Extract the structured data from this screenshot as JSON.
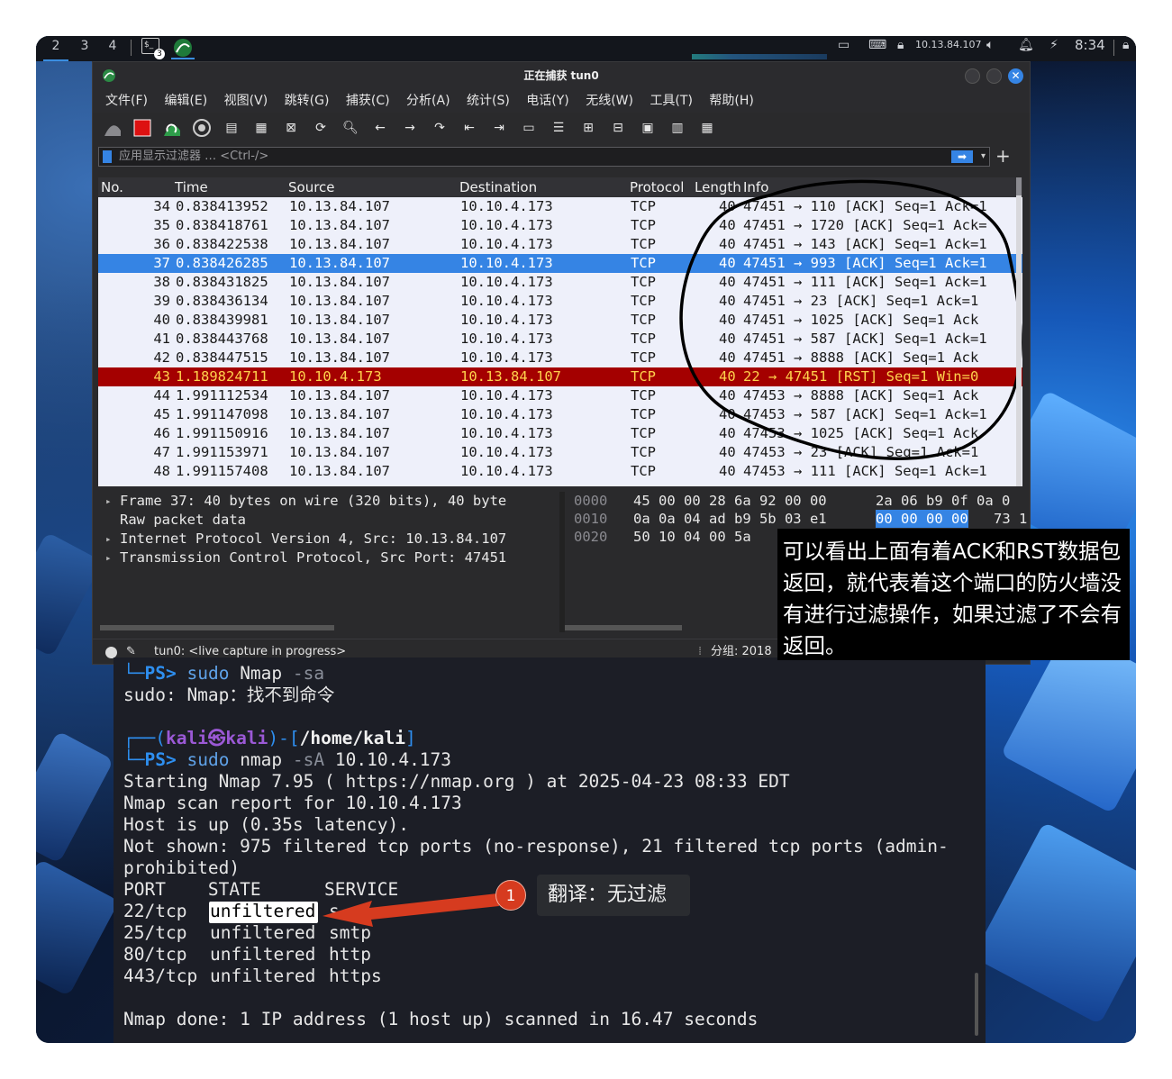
{
  "panel": {
    "workspaces": [
      "2",
      "3",
      "4"
    ],
    "terminal_count": "3",
    "ip": "10.13.84.107",
    "clock": "8:34"
  },
  "wireshark": {
    "title": "正在捕获 tun0",
    "menus": [
      "文件(F)",
      "编辑(E)",
      "视图(V)",
      "跳转(G)",
      "捕获(C)",
      "分析(A)",
      "统计(S)",
      "电话(Y)",
      "无线(W)",
      "工具(T)",
      "帮助(H)"
    ],
    "filter_placeholder": "应用显示过滤器 … <Ctrl-/>",
    "columns": [
      "No.",
      "Time",
      "Source",
      "Destination",
      "Protocol",
      "Length",
      "Info"
    ],
    "packets": [
      {
        "no": "34",
        "time": "0.838413952",
        "src": "10.13.84.107",
        "dst": "10.10.4.173",
        "proto": "TCP",
        "len": "40",
        "info": "47451 → 110 [ACK] Seq=1 Ack=1",
        "style": ""
      },
      {
        "no": "35",
        "time": "0.838418761",
        "src": "10.13.84.107",
        "dst": "10.10.4.173",
        "proto": "TCP",
        "len": "40",
        "info": "47451 → 1720 [ACK] Seq=1 Ack=",
        "style": ""
      },
      {
        "no": "36",
        "time": "0.838422538",
        "src": "10.13.84.107",
        "dst": "10.10.4.173",
        "proto": "TCP",
        "len": "40",
        "info": "47451 → 143 [ACK] Seq=1 Ack=1",
        "style": ""
      },
      {
        "no": "37",
        "time": "0.838426285",
        "src": "10.13.84.107",
        "dst": "10.10.4.173",
        "proto": "TCP",
        "len": "40",
        "info": "47451 → 993 [ACK] Seq=1 Ack=1",
        "style": "sel"
      },
      {
        "no": "38",
        "time": "0.838431825",
        "src": "10.13.84.107",
        "dst": "10.10.4.173",
        "proto": "TCP",
        "len": "40",
        "info": "47451 → 111 [ACK] Seq=1 Ack=1",
        "style": ""
      },
      {
        "no": "39",
        "time": "0.838436134",
        "src": "10.13.84.107",
        "dst": "10.10.4.173",
        "proto": "TCP",
        "len": "40",
        "info": "47451 → 23 [ACK] Seq=1 Ack=1",
        "style": ""
      },
      {
        "no": "40",
        "time": "0.838439981",
        "src": "10.13.84.107",
        "dst": "10.10.4.173",
        "proto": "TCP",
        "len": "40",
        "info": "47451 → 1025 [ACK] Seq=1 Ack",
        "style": ""
      },
      {
        "no": "41",
        "time": "0.838443768",
        "src": "10.13.84.107",
        "dst": "10.10.4.173",
        "proto": "TCP",
        "len": "40",
        "info": "47451 → 587 [ACK] Seq=1 Ack=1",
        "style": ""
      },
      {
        "no": "42",
        "time": "0.838447515",
        "src": "10.13.84.107",
        "dst": "10.10.4.173",
        "proto": "TCP",
        "len": "40",
        "info": "47451 → 8888 [ACK] Seq=1 Ack",
        "style": ""
      },
      {
        "no": "43",
        "time": "1.189824711",
        "src": "10.10.4.173",
        "dst": "10.13.84.107",
        "proto": "TCP",
        "len": "40",
        "info": "22 → 47451 [RST] Seq=1 Win=0",
        "style": "rst"
      },
      {
        "no": "44",
        "time": "1.991112534",
        "src": "10.13.84.107",
        "dst": "10.10.4.173",
        "proto": "TCP",
        "len": "40",
        "info": "47453 → 8888 [ACK] Seq=1 Ack",
        "style": ""
      },
      {
        "no": "45",
        "time": "1.991147098",
        "src": "10.13.84.107",
        "dst": "10.10.4.173",
        "proto": "TCP",
        "len": "40",
        "info": "47453 → 587 [ACK] Seq=1 Ack=1",
        "style": ""
      },
      {
        "no": "46",
        "time": "1.991150916",
        "src": "10.13.84.107",
        "dst": "10.10.4.173",
        "proto": "TCP",
        "len": "40",
        "info": "47453 → 1025 [ACK] Seq=1 Ack",
        "style": ""
      },
      {
        "no": "47",
        "time": "1.991153971",
        "src": "10.13.84.107",
        "dst": "10.10.4.173",
        "proto": "TCP",
        "len": "40",
        "info": "47453 → 23 [ACK] Seq=1 Ack=1",
        "style": ""
      },
      {
        "no": "48",
        "time": "1.991157408",
        "src": "10.13.84.107",
        "dst": "10.10.4.173",
        "proto": "TCP",
        "len": "40",
        "info": "47453 → 111 [ACK] Seq=1 Ack=1",
        "style": ""
      }
    ],
    "details": [
      "Frame 37: 40 bytes on wire (320 bits), 40 byte",
      "Raw packet data",
      "Internet Protocol Version 4, Src: 10.13.84.107",
      "Transmission Control Protocol, Src Port: 47451"
    ],
    "hex": [
      {
        "offset": "0000",
        "bytes_a": "45 00 00 28 6a 92 00 00",
        "bytes_b": "2a 06 b9 0f 0a 0"
      },
      {
        "offset": "0010",
        "bytes_a": "0a 0a 04 ad b9 5b 03 e1",
        "bytes_b": "00 00 00 00",
        "bytes_c": "73 1"
      },
      {
        "offset": "0020",
        "bytes_a": "50 10 04 00 5a"
      }
    ],
    "status_text": "tun0: <live capture in progress>",
    "packet_count": "分组: 2018"
  },
  "terminal": {
    "ps_prompt": "PS>",
    "cmd1": {
      "sudo": "sudo",
      "prog": "Nmap",
      "flag": "-sa"
    },
    "error_line": "sudo: Nmap：找不到命令",
    "user": "kali㉿kali",
    "path": "/home/kali",
    "cmd2": {
      "sudo": "sudo",
      "prog": "nmap",
      "flag": "-sA",
      "target": "10.10.4.173"
    },
    "output": [
      "Starting Nmap 7.95 ( https://nmap.org ) at 2025-04-23 08:33 EDT",
      "Nmap scan report for 10.10.4.173",
      "Host is up (0.35s latency).",
      "Not shown: 975 filtered tcp ports (no-response), 21 filtered tcp ports (admin-",
      "prohibited)",
      "PORT    STATE      SERVICE"
    ],
    "ports": [
      {
        "port": "22/tcp",
        "state": "unfiltered",
        "service": "s"
      },
      {
        "port": "25/tcp",
        "state": "unfiltered",
        "service": "smtp"
      },
      {
        "port": "80/tcp",
        "state": "unfiltered",
        "service": "http"
      },
      {
        "port": "443/tcp",
        "state": "unfiltered",
        "service": "https"
      }
    ],
    "done_line": "Nmap done: 1 IP address (1 host up) scanned in 16.47 seconds"
  },
  "annotations": {
    "badge": "1",
    "translation": "翻译：无过滤",
    "note": "可以看出上面有着ACK和RST数据包返回，就代表着这个端口的防火墙没有进行过滤操作，如果过滤了不会有返回。"
  }
}
